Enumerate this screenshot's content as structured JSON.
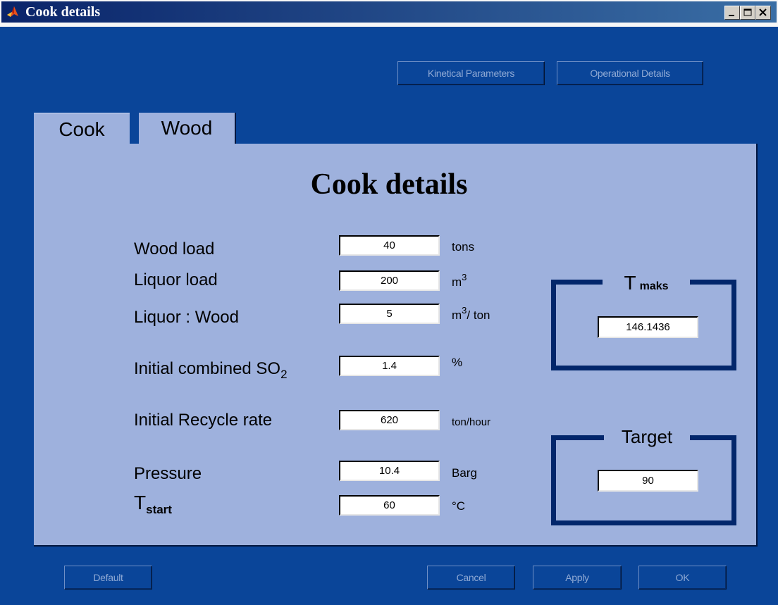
{
  "window": {
    "title": "Cook details",
    "controls": {
      "minimize": "minimize",
      "maximize": "maximize",
      "close": "close"
    }
  },
  "toolbar": {
    "kinetical_parameters": "Kinetical Parameters",
    "operational_details": "Operational Details"
  },
  "tabs": [
    {
      "label": "Cook",
      "active": true
    },
    {
      "label": "Wood",
      "active": false
    }
  ],
  "panel": {
    "heading": "Cook details",
    "fields": {
      "wood_load": {
        "label": "Wood load",
        "value": "40",
        "unit": "tons"
      },
      "liquor_load": {
        "label": "Liquor load",
        "value": "200",
        "unit": "m",
        "unit_sup": "3"
      },
      "liquor_wood": {
        "label": "Liquor : Wood",
        "value": "5",
        "unit_prefix": "m",
        "unit_sup": "3",
        "unit_suffix": "/ ton"
      },
      "initial_so2": {
        "label": "Initial combined SO",
        "label_sub": "2",
        "value": "1.4",
        "unit": "%"
      },
      "recycle_rate": {
        "label": "Initial Recycle rate",
        "value": "620",
        "unit": "ton/hour"
      },
      "pressure": {
        "label": "Pressure",
        "value": "10.4",
        "unit": "Barg"
      },
      "t_start": {
        "label": "T",
        "label_sub": "start",
        "value": "60",
        "unit": "°C"
      }
    },
    "t_maks": {
      "label": "T",
      "label_sub": "maks",
      "value": "146.1436"
    },
    "target": {
      "label": "Target",
      "value": "90"
    }
  },
  "footer": {
    "default": "Default",
    "cancel": "Cancel",
    "apply": "Apply",
    "ok": "OK"
  },
  "colors": {
    "window_bg": "#0a4599",
    "panel_bg": "#9eb1dd",
    "frame_border": "#02266b",
    "titlebar_start": "#0a246a",
    "titlebar_end": "#3a6ea5"
  }
}
